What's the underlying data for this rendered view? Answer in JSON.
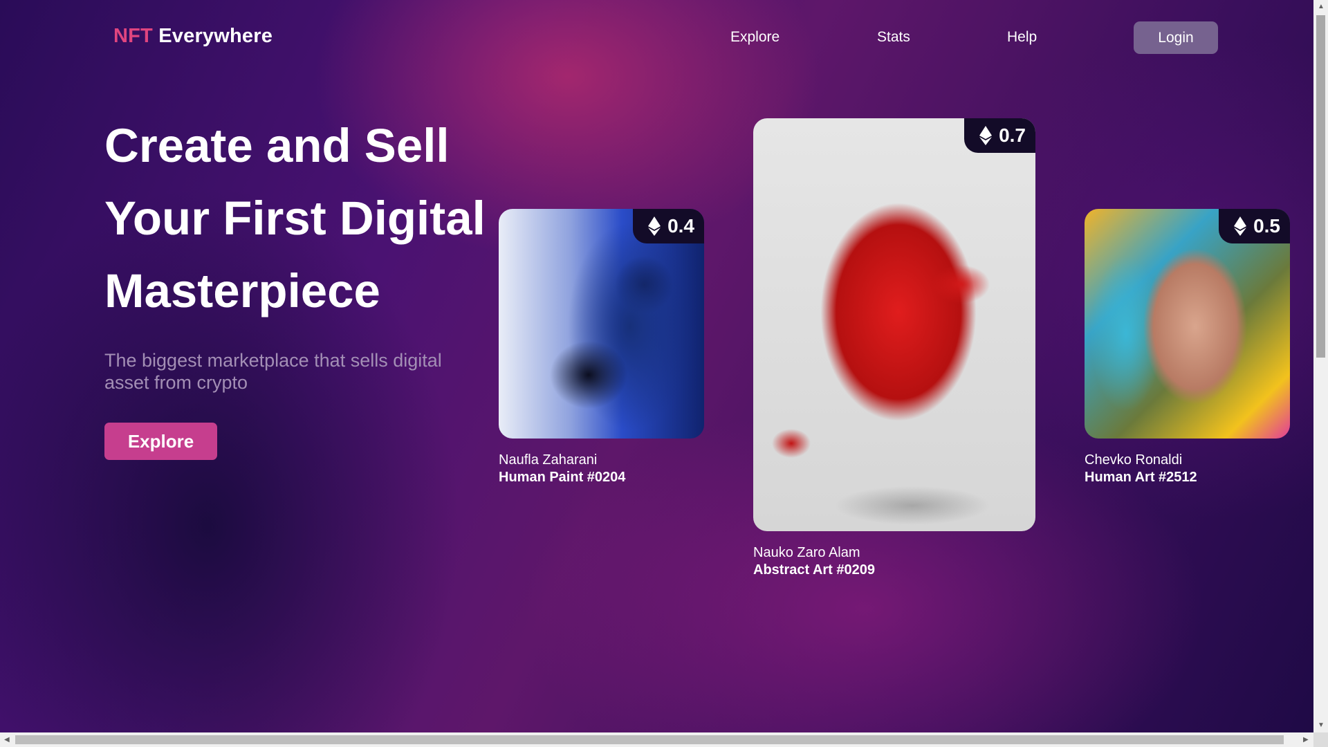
{
  "header": {
    "logo_nft": "NFT",
    "logo_rest": "Everywhere",
    "nav": [
      "Explore",
      "Stats",
      "Help"
    ],
    "login_label": "Login"
  },
  "hero": {
    "title_lines": [
      "Create and Sell",
      "Your First Digital",
      "Masterpiece"
    ],
    "subtitle": "The biggest marketplace that sells digital asset from crypto",
    "cta_label": "Explore"
  },
  "cards": [
    {
      "price": "0.4",
      "artist": "Naufla Zaharani",
      "piece": "Human Paint #0204"
    },
    {
      "price": "0.7",
      "artist": "Nauko Zaro Alam",
      "piece": "Abstract Art #0209"
    },
    {
      "price": "0.5",
      "artist": "Chevko Ronaldi",
      "piece": "Human Art #2512"
    }
  ],
  "colors": {
    "brand_pink": "#e0457f",
    "cta_bg": "#c63e8e",
    "login_bg": "#76628f",
    "price_tag_bg": "#130b28"
  },
  "icons": {
    "price_currency": "ethereum-icon"
  }
}
